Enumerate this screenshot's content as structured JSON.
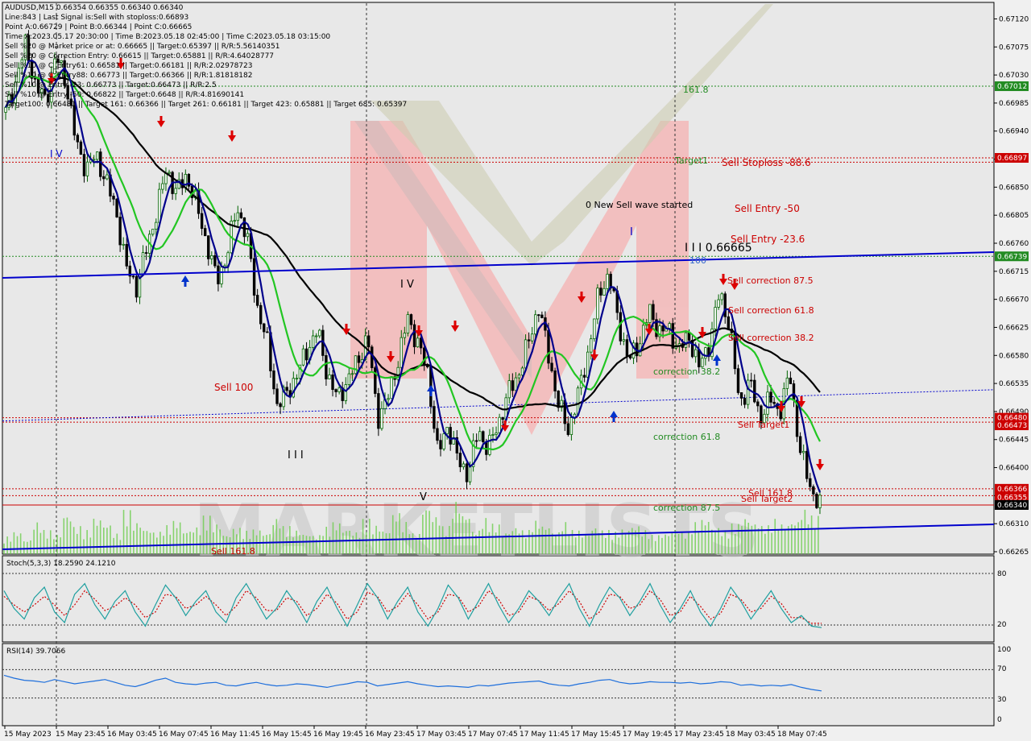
{
  "colors": {
    "background": "#e8e8e8",
    "bull_candle": "#006400",
    "bear_candle": "#000000",
    "ma_fast": "#00008b",
    "ma_mid": "#22c622",
    "ma_slow": "#000000",
    "channel": "#0000cc",
    "target_green": "#228b22",
    "sell_red": "#cc0000",
    "stoch_main": "#20a0a0",
    "stoch_signal": "#cc0000",
    "rsi": "#1e6fdc"
  },
  "info_panel": {
    "symbol": "AUDUSD,M15  0.66354 0.66355 0.66340 0.66340",
    "line2": "Line:843 | Last Signal is:Sell with stoploss:0.66893",
    "line3": "Point A:0.66729 | Point B:0.66344 | Point C:0.66665",
    "line4": "Time A:2023.05.17 20:30:00 | Time B:2023.05.18 02:45:00 | Time C:2023.05.18 03:15:00",
    "line5": "Sell %20 @ Market price or at: 0.66665 || Target:0.65397 || R/R:5.56140351",
    "line6": "Sell %20 @ Correction Entry: 0.66615 || Target:0.65881 || R/R:4.64028777",
    "line7": "Sell %10 @ C_Entry61: 0.66581 || Target:0.66181 || R/R:2.02978723",
    "line8": "Sell %10 @ C_Entry88: 0.66773 || Target:0.66366 || R/R:1.81818182",
    "line9": "Sell %10 @ Entry -23: 0.66773 || Target:0.66473 || R/R:2.5",
    "line10": "Sell %10 @ Entry -50: 0.66822 || Target:0.6648 || R/R:4.81690141",
    "line11": "Target100: 0.66481 || Target 161: 0.66366 || Target 261: 0.66181 || Target 423: 0.65881 || Target 685: 0.65397"
  },
  "annotations": {
    "level_161": "161.8",
    "target1": "Target1",
    "sell_stoploss": "Sell Stoploss -88.6",
    "new_wave": "0 New Sell wave started",
    "sell_entry_50": "Sell Entry -50",
    "sell_entry_23": "Sell Entry -23.6",
    "wave_label": "I I I 0.66665",
    "hundred": "100",
    "wave_ii": "I",
    "sell_corr_875": "Sell correction 87.5",
    "sell_corr_618": "Sell correction 61.8",
    "sell_corr_382": "Sell correction 38.2",
    "corr_382": "correction 38.2",
    "corr_618": "correction 61.8",
    "corr_875": "correction 87.5",
    "sell_100": "Sell 100",
    "sell_161_8": "Sell 161.8",
    "sell_target2": "Sell Target2",
    "sell_target1": "Sell Target1",
    "wave_iv": "I V",
    "wave_iii": "I I I",
    "wave_v": "V",
    "wave_iv_left": "I V",
    "sell_1618_bottom": "Sell 161.8"
  },
  "price_axis": {
    "ticks": [
      "0.67120",
      "0.67075",
      "0.67030",
      "0.66985",
      "0.66940",
      "0.66895",
      "0.66850",
      "0.66805",
      "0.66760",
      "0.66715",
      "0.66670",
      "0.66625",
      "0.66580",
      "0.66535",
      "0.66490",
      "0.66445",
      "0.66400",
      "0.66355",
      "0.66310",
      "0.66265"
    ],
    "labels": [
      {
        "text": "0.67012",
        "color": "#228b22"
      },
      {
        "text": "0.66897",
        "color": "#cc0000"
      },
      {
        "text": "0.66739",
        "color": "#228b22"
      },
      {
        "text": "0.66480",
        "color": "#cc0000"
      },
      {
        "text": "0.66473",
        "color": "#cc0000"
      },
      {
        "text": "0.66366",
        "color": "#cc0000"
      },
      {
        "text": "0.66355",
        "color": "#cc0000"
      },
      {
        "text": "0.66340",
        "color": "#000000"
      }
    ]
  },
  "stoch": {
    "label": "Stoch(5,3,3) 18.2590 24.1210",
    "levels": [
      "80",
      "20"
    ]
  },
  "rsi": {
    "label": "RSI(14) 39.7066",
    "levels": [
      "100",
      "70",
      "30",
      "0"
    ]
  },
  "time_axis": [
    "15 May 2023",
    "15 May 23:45",
    "16 May 03:45",
    "16 May 07:45",
    "16 May 11:45",
    "16 May 15:45",
    "16 May 19:45",
    "16 May 23:45",
    "17 May 03:45",
    "17 May 07:45",
    "17 May 11:45",
    "17 May 15:45",
    "17 May 19:45",
    "17 May 23:45",
    "18 May 03:45",
    "18 May 07:45"
  ],
  "chart_data": {
    "type": "candlestick",
    "symbol": "AUDUSD",
    "timeframe": "M15",
    "ylim": [
      0.66265,
      0.6714
    ],
    "close_path": [
      0.6697,
      0.6702,
      0.6708,
      0.6701,
      0.6699,
      0.6706,
      0.6702,
      0.6692,
      0.6688,
      0.669,
      0.6686,
      0.6681,
      0.6672,
      0.6669,
      0.6675,
      0.6681,
      0.6688,
      0.6684,
      0.6687,
      0.6682,
      0.6676,
      0.667,
      0.6674,
      0.6682,
      0.6677,
      0.6666,
      0.666,
      0.665,
      0.6652,
      0.6655,
      0.6659,
      0.6662,
      0.6655,
      0.6651,
      0.6654,
      0.6657,
      0.6661,
      0.6648,
      0.6651,
      0.6657,
      0.6664,
      0.666,
      0.6655,
      0.6642,
      0.6647,
      0.6641,
      0.6639,
      0.6646,
      0.6643,
      0.6647,
      0.6652,
      0.6655,
      0.666,
      0.6666,
      0.6658,
      0.665,
      0.6646,
      0.6652,
      0.6659,
      0.6668,
      0.6671,
      0.6663,
      0.6657,
      0.666,
      0.6665,
      0.6662,
      0.6662,
      0.6659,
      0.6661,
      0.6656,
      0.666,
      0.6668,
      0.6663,
      0.665,
      0.6654,
      0.6648,
      0.6651,
      0.6649,
      0.6655,
      0.6643,
      0.6637,
      0.6634
    ],
    "volume_path": [
      22,
      28,
      18,
      40,
      30,
      25,
      50,
      35,
      30,
      45,
      38,
      26,
      55,
      40,
      32,
      28,
      36,
      42,
      30,
      34,
      48,
      38,
      25,
      33,
      29,
      31,
      27,
      45,
      35,
      30,
      26,
      24,
      34,
      40,
      32,
      28,
      44,
      36,
      30,
      52,
      40,
      26,
      60,
      48,
      35,
      66,
      50,
      30,
      45,
      38,
      28,
      34,
      30,
      42,
      36,
      28,
      40,
      30,
      26,
      34,
      30,
      28,
      32,
      36,
      30,
      24,
      26,
      32,
      28,
      40,
      44,
      34,
      30,
      38,
      46,
      40,
      36,
      44,
      38,
      42,
      56,
      48
    ],
    "stoch_main": [
      70,
      45,
      30,
      60,
      75,
      40,
      25,
      65,
      80,
      50,
      30,
      55,
      70,
      40,
      20,
      50,
      78,
      60,
      35,
      55,
      70,
      40,
      25,
      60,
      80,
      55,
      30,
      45,
      70,
      50,
      25,
      55,
      75,
      45,
      20,
      50,
      80,
      60,
      30,
      55,
      75,
      40,
      20,
      45,
      78,
      60,
      30,
      55,
      80,
      50,
      25,
      45,
      70,
      55,
      35,
      60,
      80,
      45,
      20,
      50,
      75,
      60,
      35,
      55,
      80,
      50,
      25,
      45,
      70,
      40,
      20,
      45,
      75,
      55,
      30,
      50,
      70,
      45,
      25,
      35,
      20,
      18
    ],
    "stoch_signal": [
      62,
      50,
      40,
      50,
      62,
      50,
      35,
      50,
      70,
      58,
      42,
      48,
      60,
      50,
      32,
      40,
      65,
      62,
      45,
      50,
      62,
      50,
      35,
      48,
      70,
      60,
      42,
      42,
      60,
      55,
      35,
      45,
      65,
      52,
      30,
      40,
      68,
      62,
      40,
      48,
      66,
      50,
      30,
      40,
      65,
      62,
      40,
      48,
      70,
      58,
      35,
      40,
      62,
      56,
      42,
      52,
      70,
      55,
      30,
      40,
      65,
      62,
      45,
      50,
      70,
      58,
      35,
      40,
      62,
      48,
      30,
      38,
      65,
      58,
      40,
      45,
      62,
      52,
      32,
      32,
      24,
      24
    ],
    "rsi_path": [
      62,
      58,
      55,
      54,
      52,
      56,
      53,
      50,
      52,
      54,
      56,
      52,
      48,
      46,
      50,
      55,
      58,
      52,
      50,
      49,
      51,
      52,
      48,
      47,
      50,
      52,
      49,
      47,
      48,
      50,
      49,
      47,
      45,
      48,
      50,
      53,
      52,
      47,
      49,
      51,
      53,
      50,
      48,
      46,
      47,
      46,
      45,
      48,
      47,
      49,
      51,
      52,
      53,
      54,
      50,
      48,
      47,
      50,
      52,
      55,
      56,
      52,
      50,
      51,
      53,
      52,
      52,
      51,
      52,
      50,
      51,
      53,
      52,
      48,
      49,
      47,
      48,
      47,
      49,
      45,
      42,
      40
    ]
  }
}
